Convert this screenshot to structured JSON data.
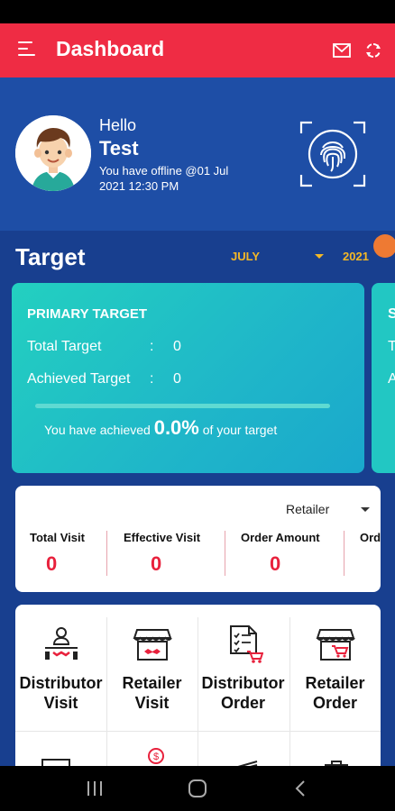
{
  "appbar": {
    "title": "Dashboard"
  },
  "profile": {
    "greeting": "Hello",
    "name": "Test",
    "status": "You have offline @01 Jul 2021 12:30 PM"
  },
  "target": {
    "title": "Target",
    "month": "JULY",
    "year": "2021"
  },
  "primary_target": {
    "title": "PRIMARY TARGET",
    "total_label": "Total Target",
    "total_value": "0",
    "achieved_label": "Achieved Target",
    "achieved_value": "0",
    "colon": ":",
    "progress_fraction": 0.0,
    "achieved_prefix": "You have achieved",
    "achieved_percent": "0.0%",
    "achieved_suffix": "of your target"
  },
  "secondary_target_peek": {
    "title": "S",
    "row1": "T",
    "row2": "A"
  },
  "visits": {
    "filter": "Retailer",
    "columns": [
      {
        "label": "Total Visit",
        "value": "0"
      },
      {
        "label": "Effective Visit",
        "value": "0"
      },
      {
        "label": "Order Amount",
        "value": "0"
      },
      {
        "label": "Ord",
        "value": ""
      }
    ]
  },
  "grid": {
    "items": [
      {
        "label_line1": "Distributor",
        "label_line2": "Visit",
        "icon": "distributor-visit-icon"
      },
      {
        "label_line1": "Retailer",
        "label_line2": "Visit",
        "icon": "retailer-visit-icon"
      },
      {
        "label_line1": "Distributor",
        "label_line2": "Order",
        "icon": "distributor-order-icon"
      },
      {
        "label_line1": "Retailer",
        "label_line2": "Order",
        "icon": "retailer-order-icon"
      }
    ]
  },
  "colors": {
    "appbar": "#ef2c44",
    "header": "#1e4ea6",
    "background": "#183f8f",
    "target_card": "#23d0c0",
    "accent_yellow": "#f4b826",
    "value_red": "#e8213c"
  }
}
